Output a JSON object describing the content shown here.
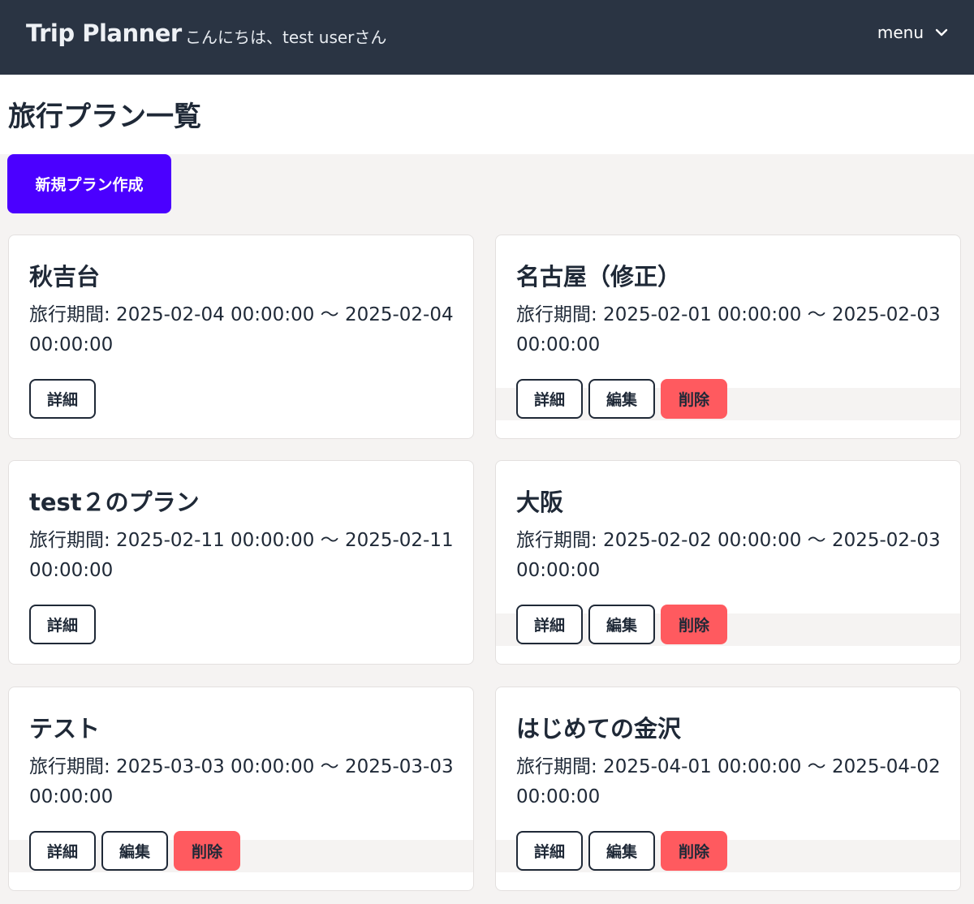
{
  "header": {
    "brand": "Trip Planner",
    "greeting": "こんにちは、test userさん",
    "menu_label": "menu",
    "menu_icon": "chevron-down-icon"
  },
  "page": {
    "title": "旅行プラン一覧",
    "new_plan_label": "新規プラン作成"
  },
  "labels": {
    "detail": "詳細",
    "edit": "編集",
    "delete": "削除"
  },
  "colors": {
    "header_bg": "#2a3443",
    "primary": "#4b00ff",
    "danger": "#ff5a5f",
    "page_bg": "#f5f3f2"
  },
  "plans": [
    {
      "title": "秋吉台",
      "period": "旅行期間: 2025-02-04 00:00:00 〜 2025-02-04 00:00:00",
      "editable": false
    },
    {
      "title": "名古屋（修正）",
      "period": "旅行期間: 2025-02-01 00:00:00 〜 2025-02-03 00:00:00",
      "editable": true
    },
    {
      "title": "test２のプラン",
      "period": "旅行期間: 2025-02-11 00:00:00 〜 2025-02-11 00:00:00",
      "editable": false
    },
    {
      "title": "大阪",
      "period": "旅行期間: 2025-02-02 00:00:00 〜 2025-02-03 00:00:00",
      "editable": true
    },
    {
      "title": "テスト",
      "period": "旅行期間: 2025-03-03 00:00:00 〜 2025-03-03 00:00:00",
      "editable": true
    },
    {
      "title": "はじめての金沢",
      "period": "旅行期間: 2025-04-01 00:00:00 〜 2025-04-02 00:00:00",
      "editable": true
    }
  ]
}
